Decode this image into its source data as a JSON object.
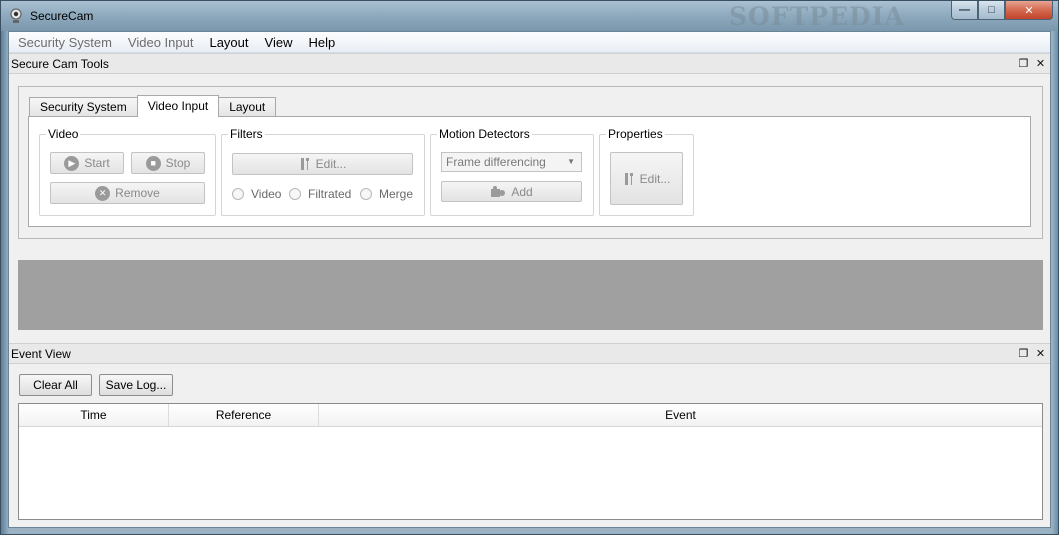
{
  "window": {
    "title": "SecureCam",
    "watermark": "SOFTPEDIA",
    "minimize_glyph": "—",
    "maximize_glyph": "□",
    "close_glyph": "✕"
  },
  "menubar": {
    "items": [
      {
        "label": "Security System",
        "enabled": false
      },
      {
        "label": "Video Input",
        "enabled": false
      },
      {
        "label": "Layout",
        "enabled": true
      },
      {
        "label": "View",
        "enabled": true
      },
      {
        "label": "Help",
        "enabled": true
      }
    ]
  },
  "tools_panel": {
    "title": "Secure Cam Tools",
    "tabs": [
      {
        "label": "Security System",
        "active": false
      },
      {
        "label": "Video Input",
        "active": true
      },
      {
        "label": "Layout",
        "active": false
      }
    ],
    "video_group": {
      "title": "Video",
      "start_label": "Start",
      "stop_label": "Stop",
      "remove_label": "Remove"
    },
    "filters_group": {
      "title": "Filters",
      "edit_label": "Edit...",
      "radio_video": "Video",
      "radio_filtrated": "Filtrated",
      "radio_merge": "Merge"
    },
    "motion_group": {
      "title": "Motion Detectors",
      "selected": "Frame differencing",
      "add_label": "Add"
    },
    "properties_group": {
      "title": "Properties",
      "edit_label": "Edit..."
    }
  },
  "event_view": {
    "title": "Event View",
    "clear_label": "Clear All",
    "save_label": "Save Log...",
    "columns": [
      "Time",
      "Reference",
      "Event"
    ]
  },
  "dock_controls": {
    "float_glyph": "❐",
    "close_glyph": "✕"
  },
  "colors": {
    "accent_gray": "#a0a0a0",
    "close_red": "#c0442a"
  }
}
